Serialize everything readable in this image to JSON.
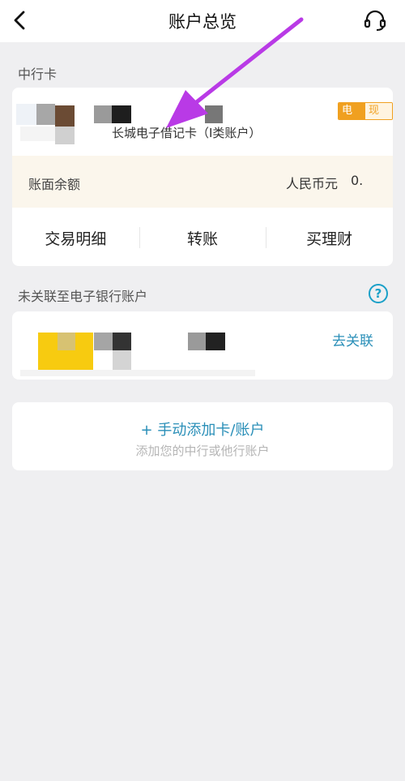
{
  "header": {
    "title": "账户总览"
  },
  "section1": {
    "label": "中行卡"
  },
  "card": {
    "name": "长城电子借记卡（I类账户）",
    "badge_left": "电子",
    "badge_right": "现金",
    "balance_label": "账面余额",
    "currency": "人民币元",
    "balance_value": "0."
  },
  "actions": [
    {
      "label": "交易明细"
    },
    {
      "label": "转账"
    },
    {
      "label": "买理财"
    }
  ],
  "section2": {
    "label": "未关联至电子银行账户"
  },
  "unlinked": {
    "link": "去关联"
  },
  "add": {
    "title": "手动添加卡/账户",
    "plus": "+",
    "subtitle": "添加您的中行或他行账户"
  },
  "colors": {
    "accent": "#2a8fb8",
    "badge": "#f0a020",
    "arrow": "#b93ae6"
  },
  "icons": {
    "back": "back-icon",
    "support": "headset-icon",
    "help": "help-icon",
    "arrow": "arrow-annotation"
  }
}
